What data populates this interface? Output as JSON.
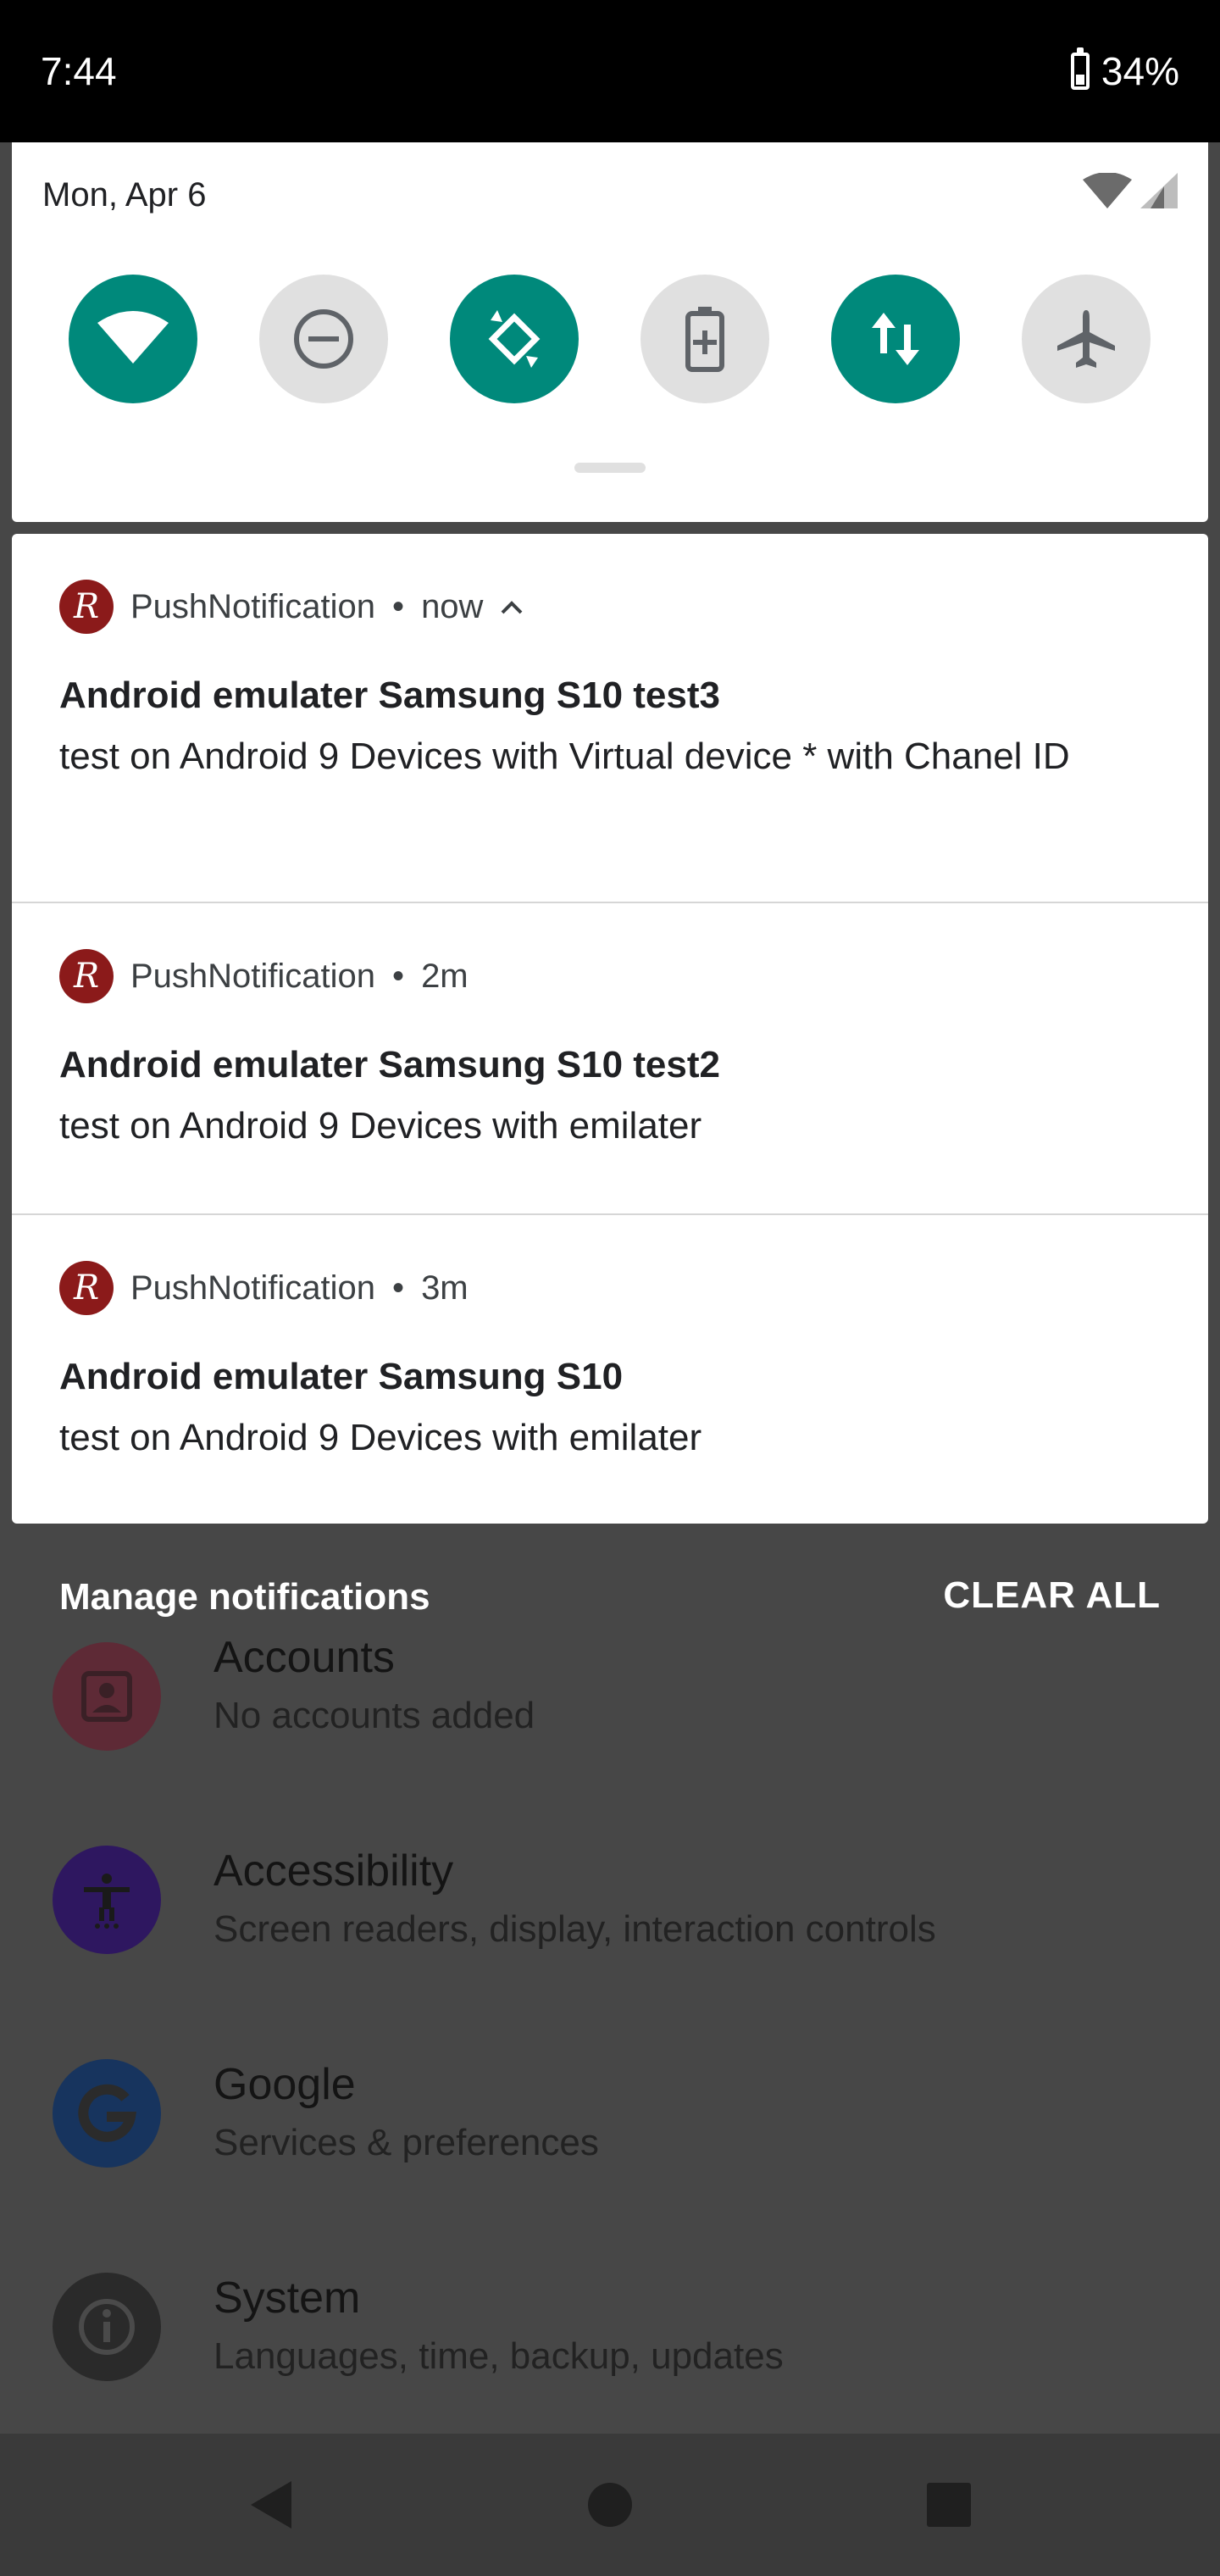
{
  "status_bar": {
    "time": "7:44",
    "battery_percent": "34%",
    "battery_level": 0.34
  },
  "quick_settings": {
    "date": "Mon, Apr 6",
    "tiles": [
      {
        "name": "wifi",
        "state": "on"
      },
      {
        "name": "do-not-disturb",
        "state": "off"
      },
      {
        "name": "auto-rotate",
        "state": "on"
      },
      {
        "name": "battery-saver",
        "state": "off"
      },
      {
        "name": "mobile-data",
        "state": "on"
      },
      {
        "name": "airplane-mode",
        "state": "off"
      }
    ]
  },
  "notifications": [
    {
      "app": "PushNotification",
      "separator": "•",
      "time": "now",
      "title": "Android emulater Samsung S10 test3",
      "body": "test on Android 9 Devices with Virtual device * with Chanel ID",
      "expanded": true
    },
    {
      "app": "PushNotification",
      "separator": "•",
      "time": "2m",
      "title": "Android emulater Samsung S10 test2",
      "body": "test on Android 9 Devices with emilater"
    },
    {
      "app": "PushNotification",
      "separator": "•",
      "time": "3m",
      "title": "Android emulater Samsung S10",
      "body": "test on Android 9 Devices with emilater"
    }
  ],
  "app_icon_letter": "R",
  "footer": {
    "manage": "Manage notifications",
    "clear_all": "CLEAR ALL"
  },
  "settings": [
    {
      "title": "Accounts",
      "subtitle": "No accounts added",
      "icon": "account-icon",
      "color": "#5e2a36"
    },
    {
      "title": "Accessibility",
      "subtitle": "Screen readers, display, interaction controls",
      "icon": "accessibility-icon",
      "color": "#2e1760"
    },
    {
      "title": "Google",
      "subtitle": "Services & preferences",
      "icon": "google-icon",
      "color": "#17345e"
    },
    {
      "title": "System",
      "subtitle": "Languages, time, backup, updates",
      "icon": "info-icon",
      "color": "#2a2a2a"
    }
  ],
  "colors": {
    "accent": "#00897b",
    "tile_off": "#e0e0e0",
    "app_icon": "#8b1a1a"
  }
}
